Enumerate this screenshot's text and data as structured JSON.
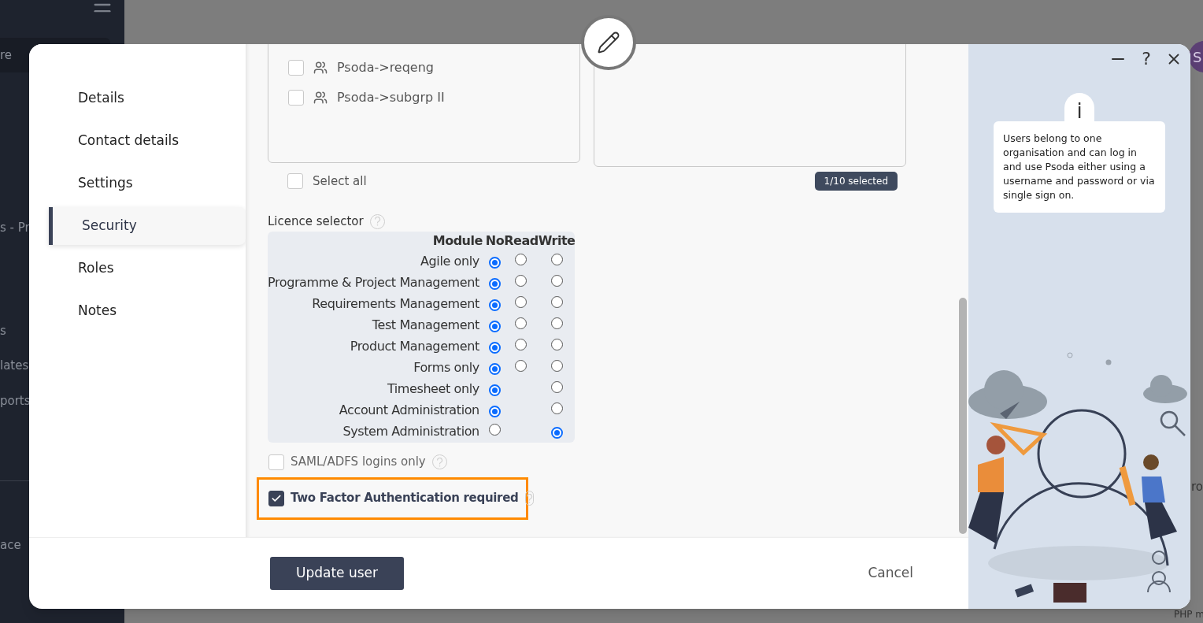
{
  "background": {
    "sidebar_items": [
      {
        "label": "re",
        "kind": "search"
      },
      {
        "label": "s - Pr",
        "kind": "item"
      },
      {
        "label": "s",
        "kind": "item"
      },
      {
        "label": "lates",
        "kind": "item"
      },
      {
        "label": "ports",
        "kind": "item"
      },
      {
        "label": "ace",
        "kind": "item"
      }
    ],
    "avatar": "S",
    "main_texts": [
      "ro",
      "PHP m"
    ]
  },
  "dialog": {
    "nav": [
      {
        "label": "Details",
        "selected": false
      },
      {
        "label": "Contact details",
        "selected": false
      },
      {
        "label": "Settings",
        "selected": false
      },
      {
        "label": "Security",
        "selected": true
      },
      {
        "label": "Roles",
        "selected": false
      },
      {
        "label": "Notes",
        "selected": false
      }
    ],
    "groups": [
      {
        "label": "Psoda->reqeng",
        "checked": false
      },
      {
        "label": "Psoda->subgrp II",
        "checked": false
      }
    ],
    "select_all": {
      "label": "Select all",
      "checked": false
    },
    "selection_count": "1/10 selected",
    "licence_selector": {
      "label": "Licence selector",
      "columns": [
        "Module",
        "No",
        "Read",
        "Write"
      ],
      "rows": [
        {
          "module": "Agile only",
          "levels": [
            {
              "kind": "radio",
              "selected": true
            },
            {
              "kind": "radio",
              "selected": false
            },
            {
              "kind": "radio",
              "selected": false
            }
          ]
        },
        {
          "module": "Programme & Project Management",
          "levels": [
            {
              "kind": "radio",
              "selected": true
            },
            {
              "kind": "radio",
              "selected": false
            },
            {
              "kind": "radio",
              "selected": false
            }
          ]
        },
        {
          "module": "Requirements Management",
          "levels": [
            {
              "kind": "radio",
              "selected": true
            },
            {
              "kind": "radio",
              "selected": false
            },
            {
              "kind": "radio",
              "selected": false
            }
          ]
        },
        {
          "module": "Test Management",
          "levels": [
            {
              "kind": "radio",
              "selected": true
            },
            {
              "kind": "radio",
              "selected": false
            },
            {
              "kind": "radio",
              "selected": false
            }
          ]
        },
        {
          "module": "Product Management",
          "levels": [
            {
              "kind": "radio",
              "selected": true
            },
            {
              "kind": "radio",
              "selected": false
            },
            {
              "kind": "radio",
              "selected": false
            }
          ]
        },
        {
          "module": "Forms only",
          "levels": [
            {
              "kind": "radio",
              "selected": true
            },
            {
              "kind": "radio",
              "selected": false
            },
            {
              "kind": "radio",
              "selected": false
            }
          ]
        },
        {
          "module": "Timesheet only",
          "levels": [
            {
              "kind": "radio",
              "selected": true
            },
            {
              "kind": "none"
            },
            {
              "kind": "radio",
              "selected": false
            }
          ]
        },
        {
          "module": "Account Administration",
          "levels": [
            {
              "kind": "radio",
              "selected": true
            },
            {
              "kind": "none"
            },
            {
              "kind": "radio",
              "selected": false
            }
          ]
        },
        {
          "module": "System Administration",
          "levels": [
            {
              "kind": "radio",
              "selected": false
            },
            {
              "kind": "none"
            },
            {
              "kind": "radio",
              "selected": true
            }
          ]
        }
      ]
    },
    "options": [
      {
        "label": "SAML/ADFS logins only",
        "checked": false,
        "highlighted": false
      },
      {
        "label": "Two Factor Authentication required",
        "checked": true,
        "highlighted": true
      }
    ],
    "primary_button": "Update user",
    "cancel_button": "Cancel"
  },
  "help_panel": {
    "help_button": "?",
    "info_glyph": "i",
    "info_text": "Users belong to one organisation and can log in and use Psoda either using a username and password or via single sign on."
  }
}
